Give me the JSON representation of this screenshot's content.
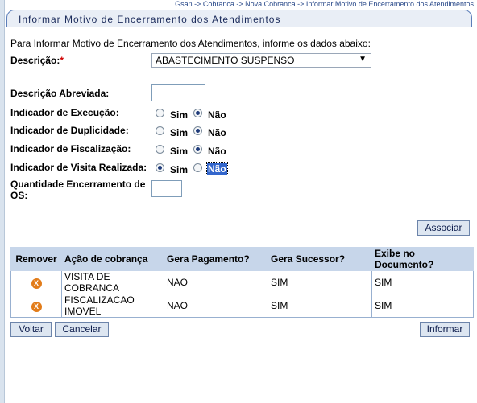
{
  "breadcrumb": "Gsan -> Cobranca -> Nova Cobranca -> Informar Motivo de Encerramento dos Atendimentos",
  "title": "Informar Motivo de Encerramento dos Atendimentos",
  "intro": "Para Informar Motivo de Encerramento dos Atendimentos, informe os dados abaixo:",
  "form": {
    "descricao_label": "Descrição:",
    "required_mark": "*",
    "descricao_value": "ABASTECIMENTO SUSPENSO",
    "descricao_abreviada_label": "Descrição Abreviada:",
    "descricao_abreviada_value": "",
    "execucao_label": "Indicador de Execução:",
    "duplicidade_label": "Indicador de Duplicidade:",
    "fiscalizacao_label": "Indicador de Fiscalização:",
    "visita_label": "Indicador de Visita Realizada:",
    "quantidade_label_line1": "Quantidade Encerramento de",
    "quantidade_label_line2": "OS:",
    "quantidade_value": "",
    "sim": "Sim",
    "nao": "Não",
    "execucao_selected": "Não",
    "duplicidade_selected": "Não",
    "fiscalizacao_selected": "Não",
    "visita_selected": "Sim"
  },
  "buttons": {
    "associar": "Associar",
    "voltar": "Voltar",
    "cancelar": "Cancelar",
    "informar": "Informar"
  },
  "table": {
    "headers": [
      "Remover",
      "Ação de cobrança",
      "Gera Pagamento?",
      "Gera Sucessor?",
      "Exibe no Documento?"
    ],
    "rows": [
      {
        "acao": "VISITA DE COBRANCA",
        "pagamento": "NAO",
        "sucessor": "SIM",
        "exibe": "SIM"
      },
      {
        "acao_line1": "FISCALIZACAO",
        "acao_line2": "IMOVEL",
        "pagamento": "NAO",
        "sucessor": "SIM",
        "exibe": "SIM"
      }
    ],
    "remove_icon": "remove-x-icon"
  }
}
